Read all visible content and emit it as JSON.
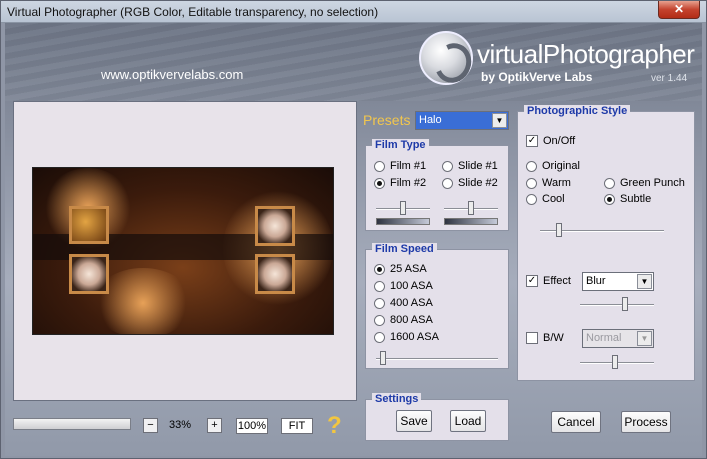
{
  "window": {
    "title": "Virtual Photographer (RGB Color, Editable transparency, no selection)",
    "close_glyph": "✕"
  },
  "header": {
    "website": "www.optikvervelabs.com",
    "logo_name": "virtualPhotographer",
    "logo_by": "by OptikVerve Labs",
    "version": "ver 1.44"
  },
  "presets": {
    "label": "Presets",
    "value": "Halo",
    "arrow": "▼"
  },
  "film_type": {
    "title": "Film Type",
    "options": [
      "Film #1",
      "Film #2",
      "Slide #1",
      "Slide #2"
    ],
    "selected": "Film #2",
    "slider_left": 0.5,
    "slider_right": 0.5
  },
  "film_speed": {
    "title": "Film Speed",
    "options": [
      "25 ASA",
      "100 ASA",
      "400 ASA",
      "800 ASA",
      "1600 ASA"
    ],
    "selected": "25 ASA",
    "slider": 0.05
  },
  "settings": {
    "title": "Settings",
    "save_label": "Save",
    "load_label": "Load"
  },
  "photographic_style": {
    "title": "Photographic Style",
    "onoff_label": "On/Off",
    "onoff_checked": true,
    "styles": [
      "Original",
      "Warm",
      "Green Punch",
      "Cool",
      "Subtle"
    ],
    "selected": "Subtle",
    "style_slider": 0.14,
    "effect_label": "Effect",
    "effect_checked": true,
    "effect_value": "Blur",
    "effect_slider": 0.6,
    "bw_label": "B/W",
    "bw_checked": false,
    "bw_value": "Normal",
    "bw_slider": 0.45
  },
  "actions": {
    "cancel_label": "Cancel",
    "process_label": "Process"
  },
  "zoom": {
    "minus": "−",
    "value": "33%",
    "plus": "+",
    "hundred_label": "100%",
    "fit_label": "FIT",
    "help_glyph": "?"
  },
  "colors": {
    "title_blue": "#1e3aa8",
    "presets_gold": "#f2c64d",
    "selection_blue": "#3a6ed6"
  }
}
